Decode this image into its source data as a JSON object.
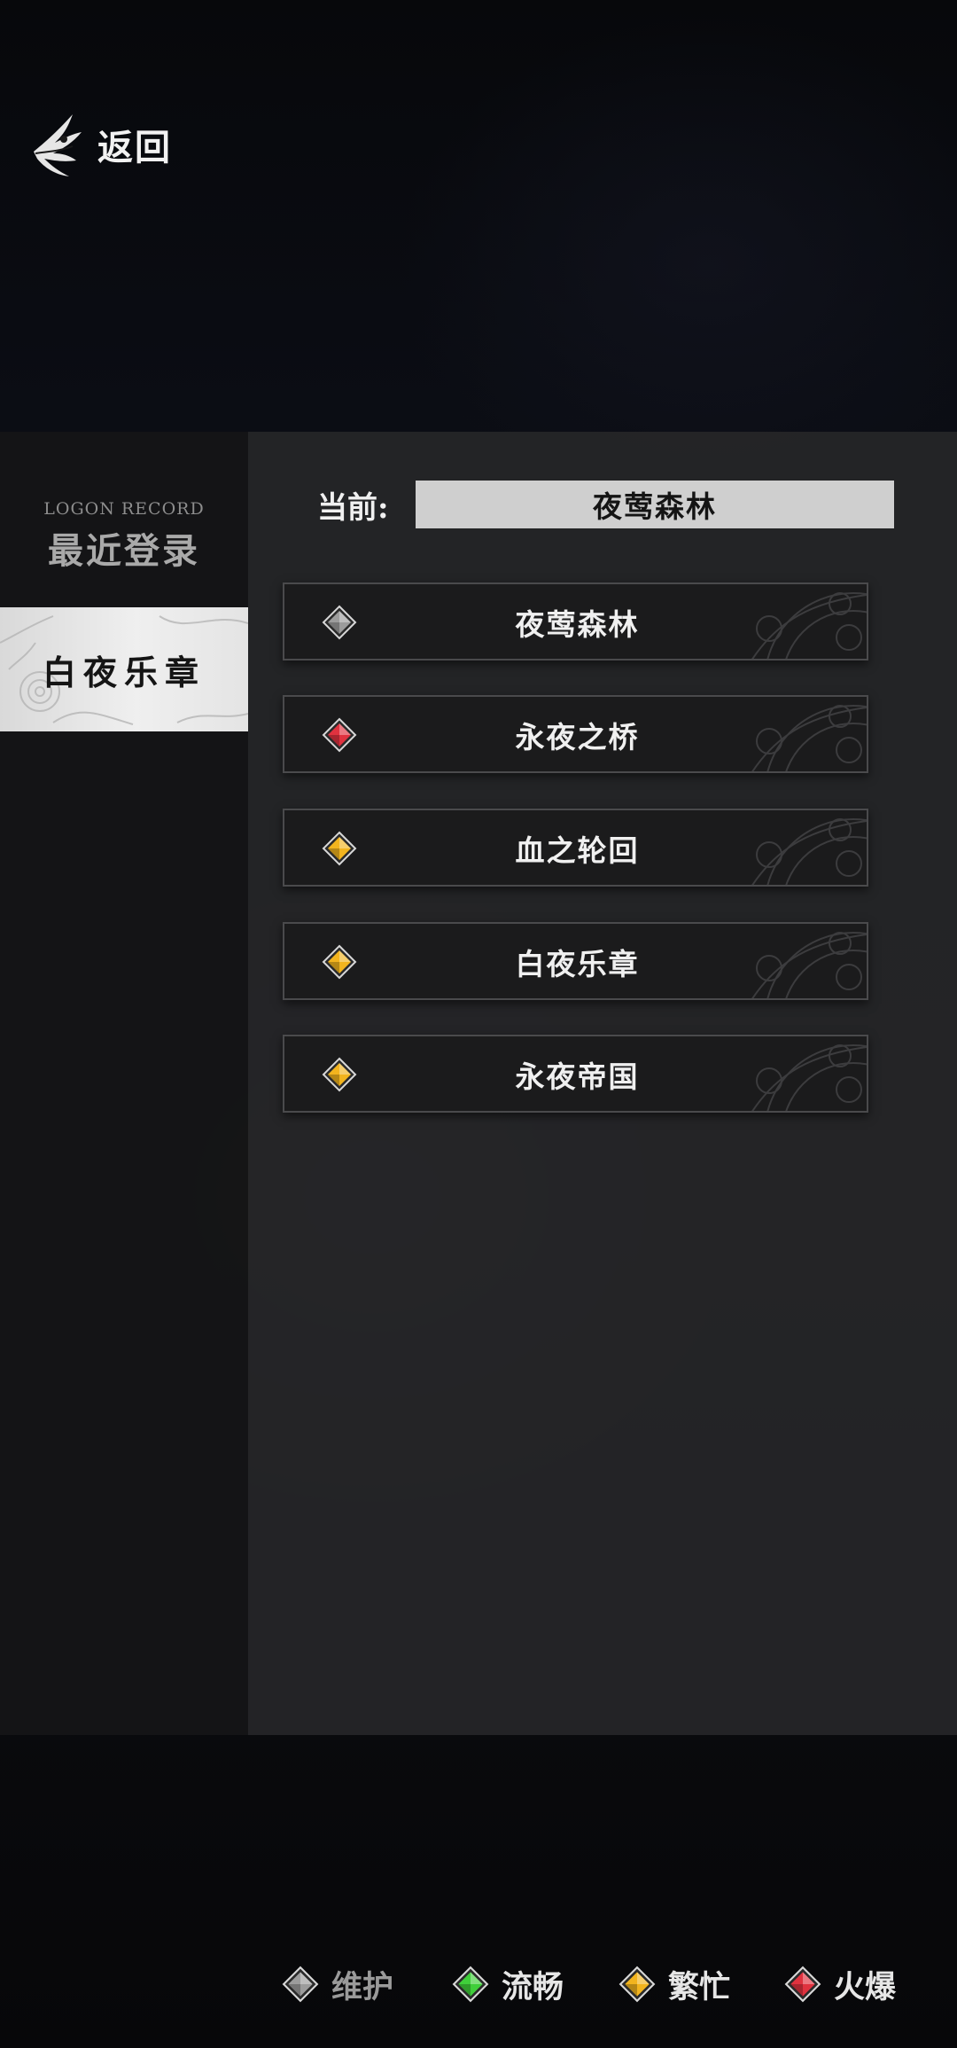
{
  "header": {
    "back_label": "返回",
    "back_icon": "feather-wing-icon"
  },
  "sidebar": {
    "record_en": "LOGON RECORD",
    "record_zh": "最近登录",
    "tab_label": "白夜乐章"
  },
  "current": {
    "label": "当前:",
    "value": "夜莺森林"
  },
  "servers": [
    {
      "name": "夜莺森林",
      "status": "maintenance",
      "color": "#9c9c9c"
    },
    {
      "name": "永夜之桥",
      "status": "hot",
      "color": "#e0323f"
    },
    {
      "name": "血之轮回",
      "status": "busy",
      "color": "#f2b41e"
    },
    {
      "name": "白夜乐章",
      "status": "busy",
      "color": "#f2b41e"
    },
    {
      "name": "永夜帝国",
      "status": "busy",
      "color": "#f2b41e"
    }
  ],
  "legend": [
    {
      "label": "维护",
      "color": "#9c9c9c"
    },
    {
      "label": "流畅",
      "color": "#3fcf3a"
    },
    {
      "label": "繁忙",
      "color": "#f2b41e"
    },
    {
      "label": "火爆",
      "color": "#e0323f"
    }
  ]
}
